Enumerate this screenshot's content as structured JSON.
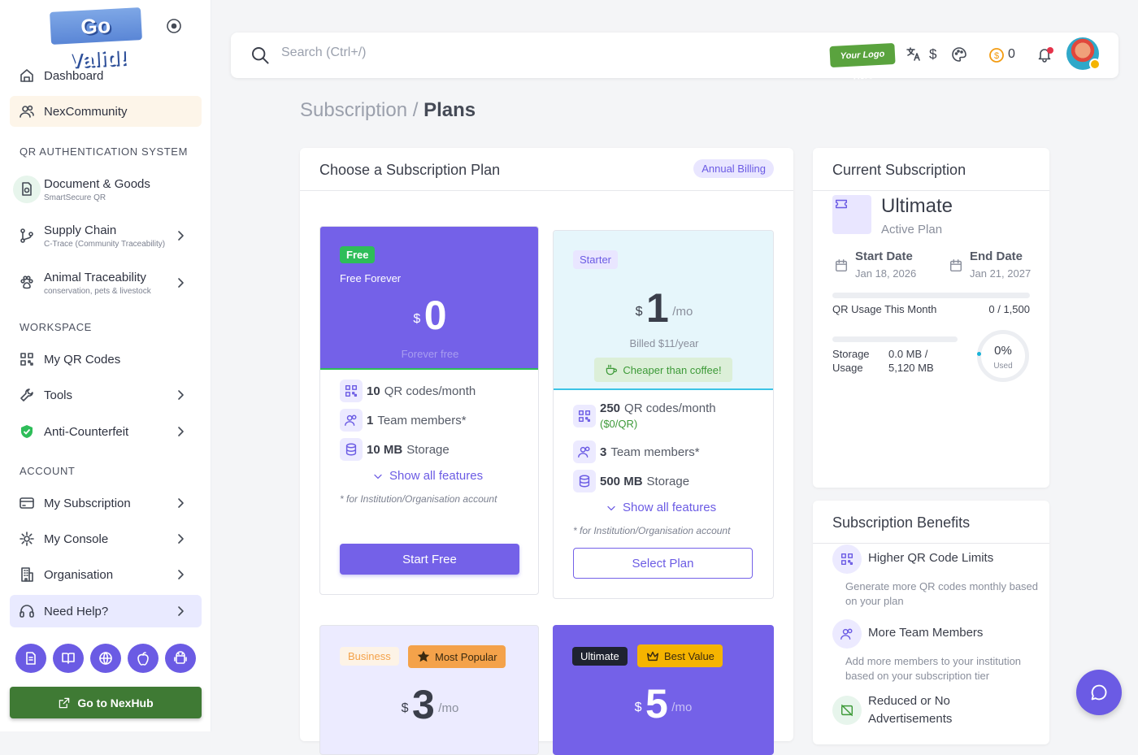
{
  "sidebar": {
    "logo_text": "Go Valid!",
    "items": {
      "dashboard": "Dashboard",
      "nexcommunity": "NexCommunity",
      "doc_goods": {
        "label": "Document & Goods",
        "sub": "SmartSecure QR"
      },
      "supply_chain": {
        "label": "Supply Chain",
        "sub": "C-Trace (Community Traceability)"
      },
      "animal": {
        "label": "Animal Traceability",
        "sub": "conservation, pets & livestock"
      },
      "my_qr": "My QR Codes",
      "tools": "Tools",
      "anti": "Anti-Counterfeit",
      "subscription": "My Subscription",
      "console": "My Console",
      "organisation": "Organisation",
      "help": "Need Help?"
    },
    "sections": {
      "qr": "QR AUTHENTICATION SYSTEM",
      "workspace": "WORKSPACE",
      "account": "ACCOUNT"
    },
    "nexhub_label": "Go to NexHub"
  },
  "topbar": {
    "search_placeholder": "Search (Ctrl+/)",
    "logo_text": "Your Logo Here",
    "currency": "$",
    "coins": "0"
  },
  "breadcrumb": {
    "parent": "Subscription / ",
    "current": "Plans"
  },
  "plans_card": {
    "title": "Choose a Subscription Plan",
    "billing": "Annual Billing",
    "free": {
      "badge": "Free",
      "tagline": "Free Forever",
      "currency": "$",
      "price": "0",
      "caption": "Forever free",
      "f1_val": "10",
      "f1": "QR codes/month",
      "f2_val": "1",
      "f2": "Team members*",
      "f3_val": "10 MB",
      "f3": "Storage",
      "show": "Show all features",
      "note": "* for Institution/Organisation account",
      "cta": "Start Free"
    },
    "starter": {
      "badge": "Starter",
      "currency": "$",
      "price": "1",
      "per": "/mo",
      "billed": "Billed $11/year",
      "promo": "Cheaper than coffee!",
      "f1_val": "250",
      "f1": "QR codes/month",
      "f1_sub": "($0/QR)",
      "f2_val": "3",
      "f2": "Team members*",
      "f3_val": "500 MB",
      "f3": "Storage",
      "show": "Show all features",
      "note": "* for Institution/Organisation account",
      "cta": "Select Plan"
    },
    "business": {
      "badge": "Business",
      "tag": "Most Popular",
      "currency": "$",
      "price": "3",
      "per": "/mo"
    },
    "ultimate": {
      "badge": "Ultimate",
      "tag": "Best Value",
      "currency": "$",
      "price": "5",
      "per": "/mo"
    }
  },
  "current": {
    "title": "Current Subscription",
    "plan": "Ultimate",
    "status": "Active Plan",
    "start_label": "Start Date",
    "start": "Jan 18, 2026",
    "end_label": "End Date",
    "end": "Jan 21, 2027",
    "qr_label": "QR Usage This Month",
    "qr_value": "0 / 1,500",
    "qr_fraction": 0,
    "storage_label": "Storage Usage",
    "storage_value": "0.0 MB / 5,120 MB",
    "storage_fraction": 0,
    "pct": "0%",
    "pct_label": "Used"
  },
  "benefits": {
    "title": "Subscription Benefits",
    "b1": "Higher QR Code Limits",
    "b1_desc": "Generate more QR codes monthly based on your plan",
    "b2": "More Team Members",
    "b2_desc": "Add more members to your institution based on your subscription tier",
    "b3": "Reduced or No Advertisements"
  },
  "colors": {
    "accent": "#6b5be4",
    "success": "#3f7a34",
    "starter_bg": "#e6f6fb",
    "warning": "#f4a24a"
  }
}
